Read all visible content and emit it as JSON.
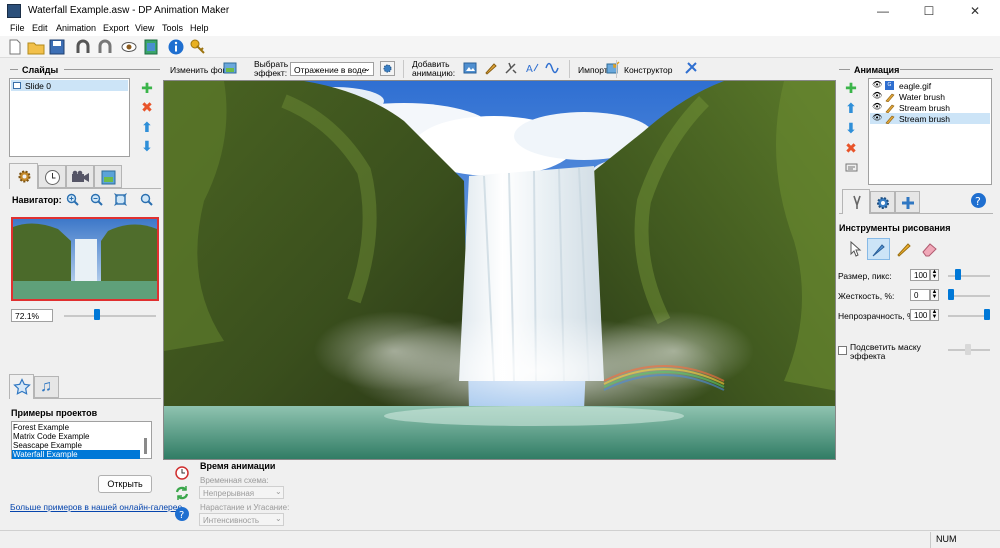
{
  "window": {
    "title": "Waterfall Example.asw - DP Animation Maker",
    "controls": [
      "—",
      "☐",
      "✕"
    ]
  },
  "menu": [
    "File",
    "Edit",
    "Animation",
    "Export",
    "View",
    "Tools",
    "Help"
  ],
  "slides": {
    "header": "Слайды",
    "items": [
      {
        "label": "Slide 0",
        "selected": true
      }
    ]
  },
  "navigator": {
    "header": "Навигатор:",
    "zoom": "72.1%",
    "zoom_fraction": 0.35
  },
  "projects": {
    "header": "Примеры проектов",
    "items": [
      {
        "label": "Forest Example",
        "selected": false
      },
      {
        "label": "Matrix Code Example",
        "selected": false
      },
      {
        "label": "Seascape Example",
        "selected": false
      },
      {
        "label": "Waterfall Example",
        "selected": true
      }
    ],
    "open_button": "Открыть",
    "more_link": "Больше примеров в нашей онлайн-галерее"
  },
  "canvas_toolbar": {
    "change_bg": "Изменить фон",
    "choose_effect_line1": "Выбрать",
    "choose_effect_line2": "эффект:",
    "effect_value": "Отражение в воде",
    "add_anim_line1": "Добавить",
    "add_anim_line2": "анимацию:",
    "import": "Импорт",
    "constructor": "Конструктор"
  },
  "timing": {
    "header": "Время анимации",
    "scheme_label": "Временная схема:",
    "scheme_value": "Непрерывная",
    "fade_label": "Нарастание и Угасание:",
    "fade_value": "Интенсивность"
  },
  "animation": {
    "header": "Анимация",
    "layers": [
      {
        "label": "eagle.gif",
        "icon": "gif-icon",
        "selected": false
      },
      {
        "label": "Water brush",
        "icon": "brush-icon",
        "selected": false
      },
      {
        "label": "Stream brush",
        "icon": "brush-icon",
        "selected": false
      },
      {
        "label": "Stream brush",
        "icon": "brush-icon",
        "selected": true
      }
    ]
  },
  "drawing": {
    "header": "Инструменты рисования",
    "size_label": "Размер, пикс:",
    "size_value": "100",
    "size_fraction": 0.2,
    "hardness_label": "Жесткость, %:",
    "hardness_value": "0",
    "hardness_fraction": 0.0,
    "opacity_label": "Непрозрачность, %:",
    "opacity_value": "100",
    "opacity_fraction": 1.0,
    "mask_label_line1": "Подсветить маску",
    "mask_label_line2": "эффекта"
  },
  "status": {
    "num": "NUM"
  },
  "colors": {
    "accent": "#0078d7",
    "selection": "#cce4f7",
    "navigator_border": "#e03030"
  }
}
